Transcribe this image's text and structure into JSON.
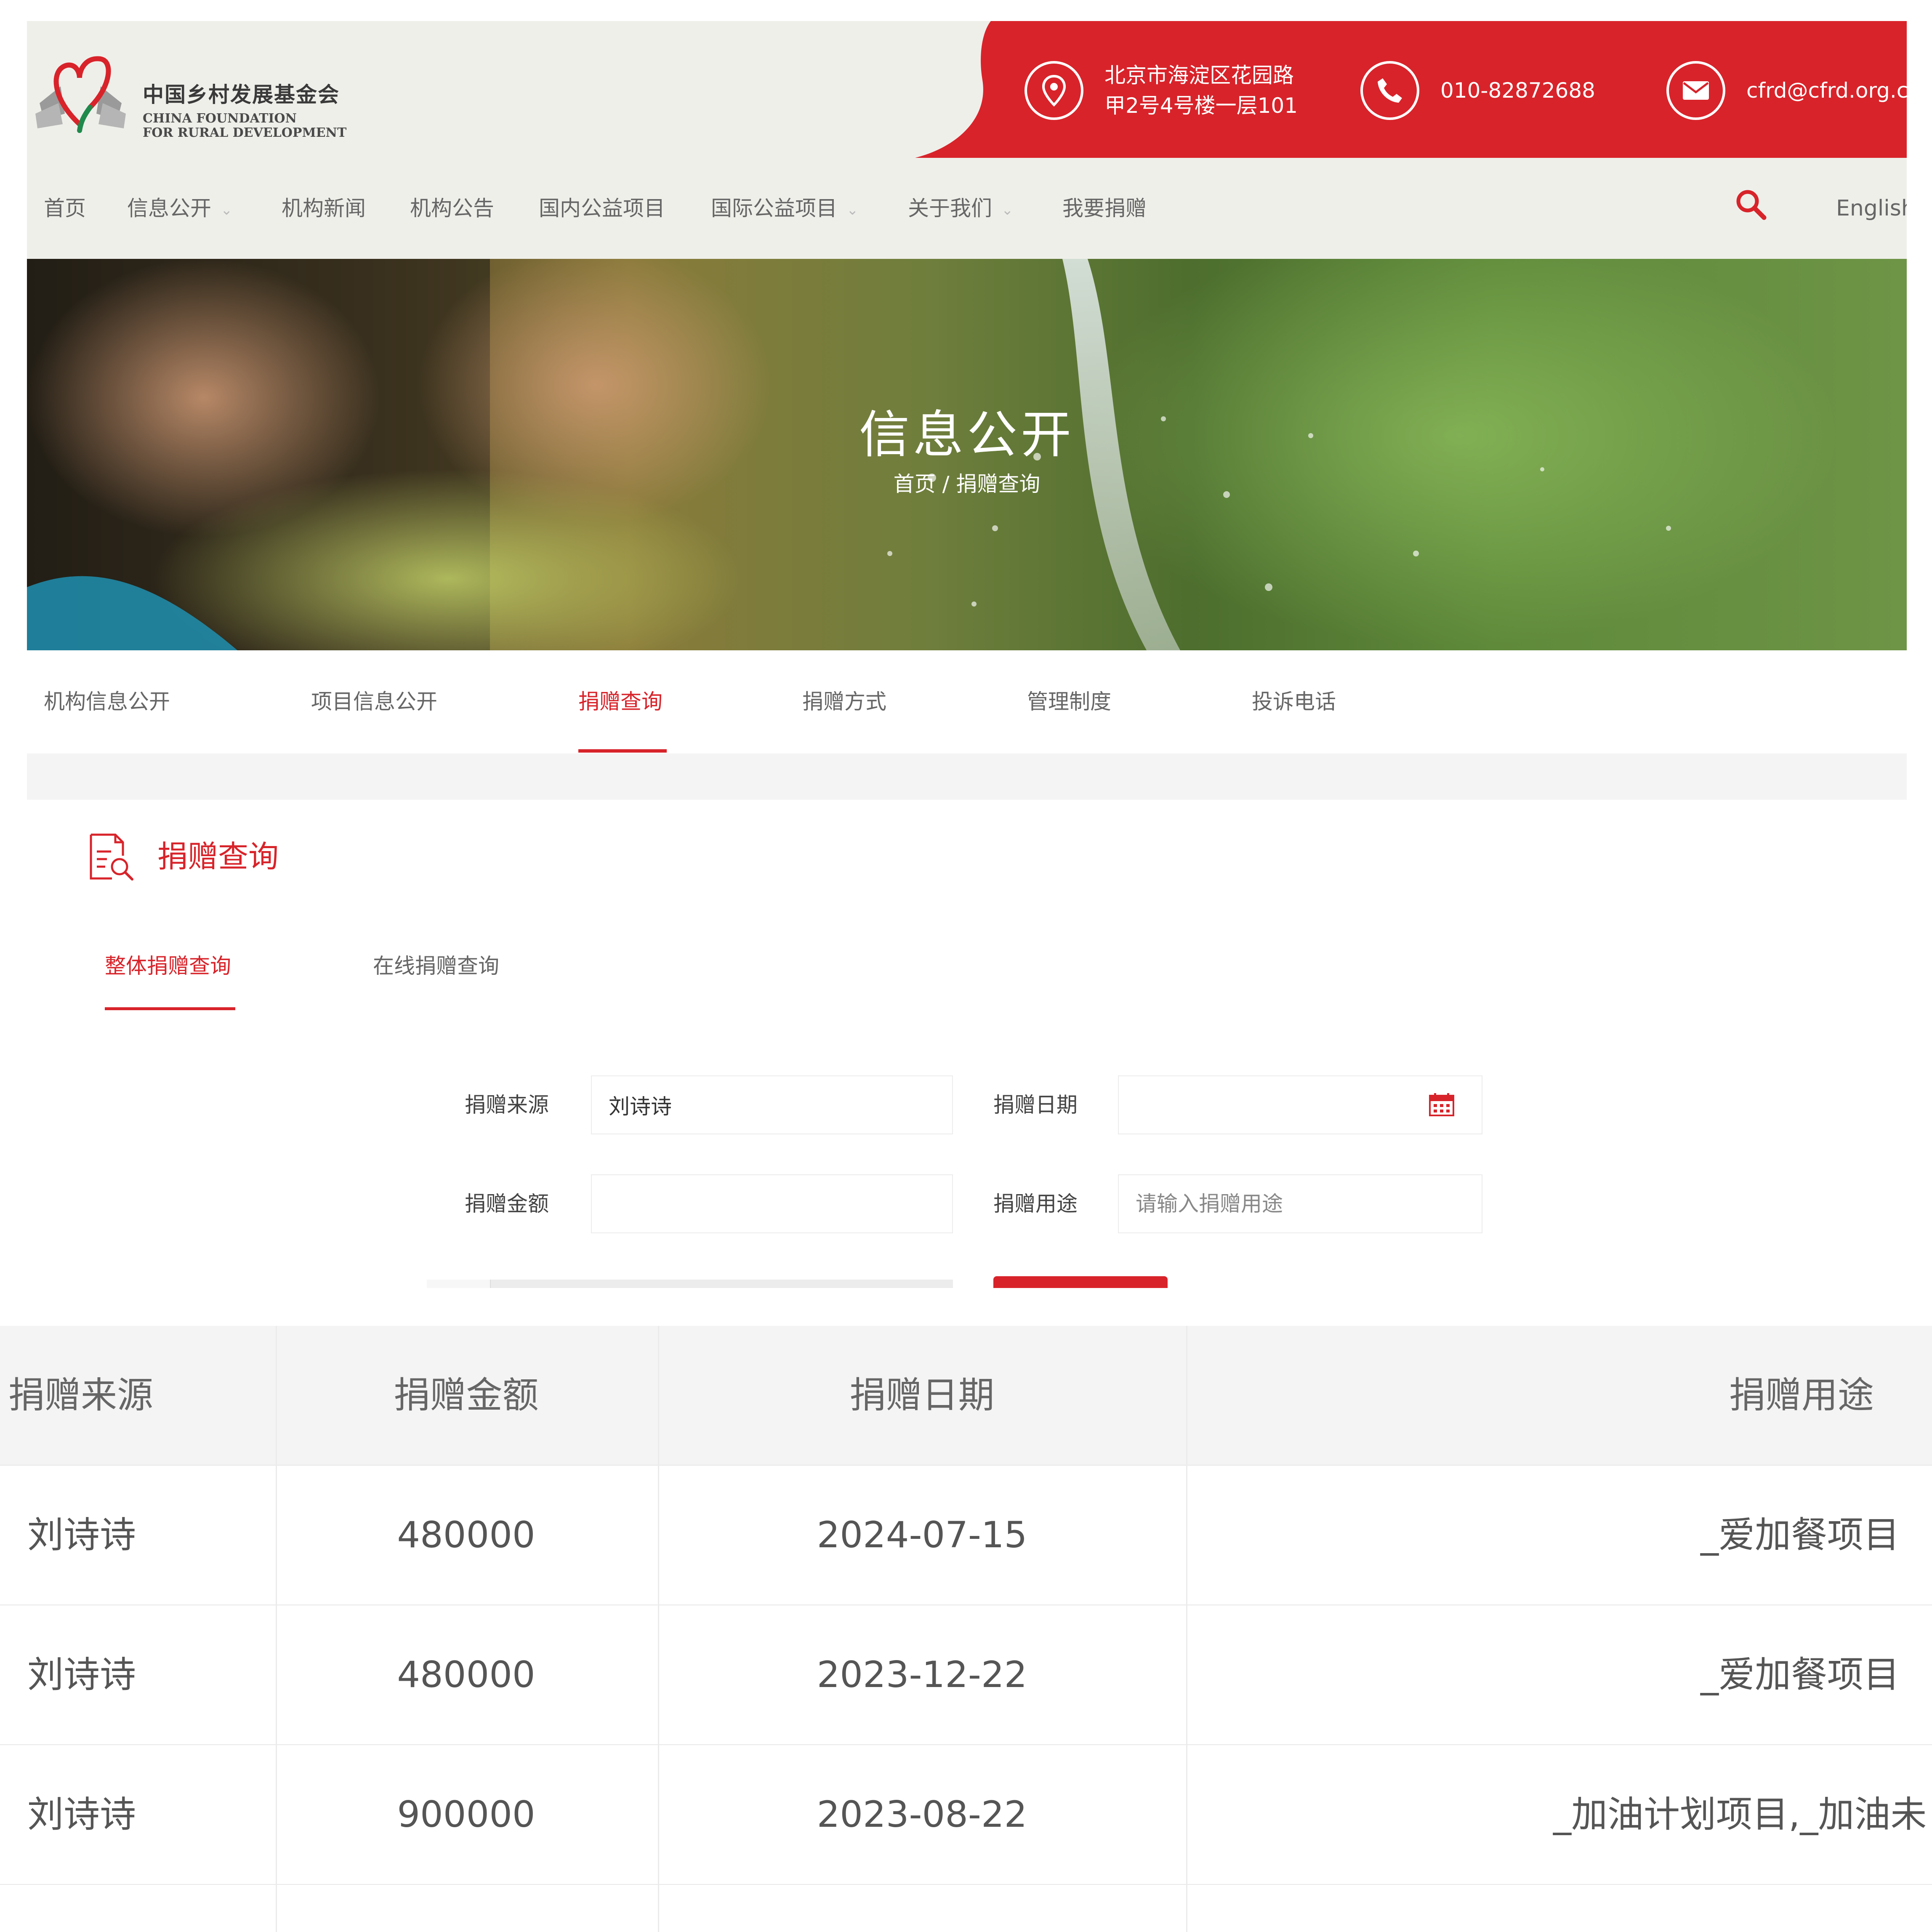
{
  "header": {
    "logo": {
      "name_cn": "中国乡村发展基金会",
      "name_en_line1": "CHINA FOUNDATION",
      "name_en_line2": "FOR RURAL DEVELOPMENT"
    },
    "address_line1": "北京市海淀区花园路",
    "address_line2": "甲2号4号楼一层101",
    "phone": "010-82872688",
    "email": "cfrd@cfrd.org.cn",
    "brand_red": "#d8232a"
  },
  "nav": {
    "items": [
      {
        "label": "首页"
      },
      {
        "label": "信息公开"
      },
      {
        "label": "机构新闻"
      },
      {
        "label": "机构公告"
      },
      {
        "label": "国内公益项目"
      },
      {
        "label": "国际公益项目"
      },
      {
        "label": "关于我们"
      },
      {
        "label": "我要捐赠"
      }
    ],
    "english": "English",
    "search_icon": "search-icon"
  },
  "banner": {
    "title": "信息公开",
    "breadcrumb": "首页 / 捐赠查询"
  },
  "subtabs": [
    {
      "label": "机构信息公开"
    },
    {
      "label": "项目信息公开"
    },
    {
      "label": "捐赠查询"
    },
    {
      "label": "捐赠方式"
    },
    {
      "label": "管理制度"
    },
    {
      "label": "投诉电话"
    }
  ],
  "section": {
    "title": "捐赠查询",
    "query_tabs": [
      {
        "label": "整体捐赠查询"
      },
      {
        "label": "在线捐赠查询"
      }
    ]
  },
  "form": {
    "source_label": "捐赠来源",
    "source_value": "刘诗诗",
    "date_label": "捐赠日期",
    "date_value": "",
    "amount_label": "捐赠金额",
    "amount_value": "",
    "purpose_label": "捐赠用途",
    "purpose_placeholder": "请输入捐赠用途"
  },
  "results": {
    "headers": [
      "捐赠来源",
      "捐赠金额",
      "捐赠日期",
      "捐赠用途"
    ],
    "rows": [
      [
        "刘诗诗",
        "480000",
        "2024-07-15",
        "_爱加餐项目"
      ],
      [
        "刘诗诗",
        "480000",
        "2023-12-22",
        "_爱加餐项目"
      ],
      [
        "刘诗诗",
        "900000",
        "2023-08-22",
        "_加油计划项目,_加油未"
      ]
    ]
  }
}
